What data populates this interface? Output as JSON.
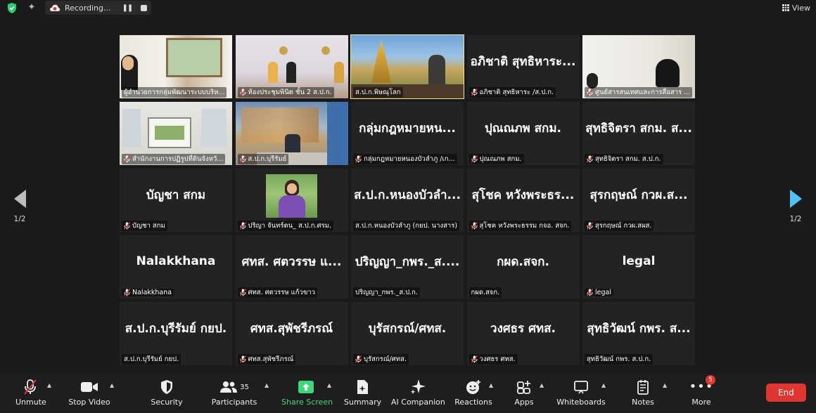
{
  "topbar": {
    "recording_label": "Recording...",
    "view_label": "View"
  },
  "gallery": {
    "tiles": [
      {
        "display_name": "",
        "label": "ผู้อำนวยการกลุ่มพัฒนาระบบบริห...",
        "muted": false,
        "has_video": true,
        "video": "v1"
      },
      {
        "display_name": "",
        "label": "ห้องประชุมพินิต ชั้น 2 ส.ป.ก.",
        "muted": true,
        "has_video": true,
        "video": "v2"
      },
      {
        "display_name": "",
        "label": "ส.ป.ก.พิษณุโลก",
        "muted": false,
        "has_video": true,
        "video": "v3",
        "active": true
      },
      {
        "display_name": "อภิชาติ สุทธิหาระ...",
        "label": "อภิชาติ สุทธิหาระ /ส.ป.ก.",
        "muted": true,
        "has_video": false
      },
      {
        "display_name": "",
        "label": "ศูนย์สารสนเทศและการสื่อสาร ...",
        "muted": true,
        "has_video": true,
        "video": "v5"
      },
      {
        "display_name": "",
        "label": "สำนักงานการปฏิรูปที่ดินจังหวั...",
        "muted": true,
        "has_video": true,
        "video": "v6"
      },
      {
        "display_name": "",
        "label": "ส.ป.ก.บุรีรัมย์",
        "muted": true,
        "has_video": true,
        "video": "v7"
      },
      {
        "display_name": "กลุ่มกฎหมายหน...",
        "label": "กลุ่มกฎหมายหนองบัวลำภู /เก...",
        "muted": true,
        "has_video": false
      },
      {
        "display_name": "ปุณณภพ สกม.",
        "label": "ปุณณภพ สกม.",
        "muted": true,
        "has_video": false
      },
      {
        "display_name": "สุทธิจิตรา สกม. ส...",
        "label": "สุทธิจิตรา สกม. ส.ป.ก.",
        "muted": true,
        "has_video": false
      },
      {
        "display_name": "บัญชา สกม",
        "label": "บัญชา สกม",
        "muted": true,
        "has_video": false
      },
      {
        "display_name": "",
        "label": "ปริญา จันทร์ตน_ ส.ป.ก.ศรม.",
        "muted": true,
        "has_video": true,
        "video": "photo"
      },
      {
        "display_name": "ส.ป.ก.หนองบัวลำ...",
        "label": "ส.ป.ก.หนองบัวลำภู (กยป. นางสาร)",
        "muted": false,
        "has_video": false
      },
      {
        "display_name": "สุโชค หวังพระธร...",
        "label": "สุโชค หวังพระธรรม กจอ. สจก.",
        "muted": true,
        "has_video": false
      },
      {
        "display_name": "สุรกฤษณ์ กวผ.ส...",
        "label": "สุรกฤษณ์ กวผ.สผส.",
        "muted": true,
        "has_video": false
      },
      {
        "display_name": "Nalakkhana",
        "label": "Nalakkhana",
        "muted": true,
        "has_video": false
      },
      {
        "display_name": "ศทส. ศตวรรษ แ...",
        "label": "ศทส. ศตวรรษ แก้วขาว",
        "muted": true,
        "has_video": false
      },
      {
        "display_name": "ปริญญา_กพร._ส....",
        "label": "ปริญญา_กพร._ส.ป.ก.",
        "muted": false,
        "has_video": false
      },
      {
        "display_name": "กผด.สจก.",
        "label": "กผด.สจก.",
        "muted": false,
        "has_video": false
      },
      {
        "display_name": "legal",
        "label": "legal",
        "muted": true,
        "has_video": false
      },
      {
        "display_name": "ส.ป.ก.บุรีรัมย์ กยป.",
        "label": "ส.ป.ก.บุรีรัมย์ กยป.",
        "muted": false,
        "has_video": false
      },
      {
        "display_name": "ศทส.สุพัชรีภรณ์",
        "label": "ศทส.สุพัชรีภรณ์",
        "muted": true,
        "has_video": false
      },
      {
        "display_name": "บุรัสกรณ์/ศทส.",
        "label": "บุรัสกรณ์/ศทส.",
        "muted": true,
        "has_video": false
      },
      {
        "display_name": "วงศธร ศทส.",
        "label": "วงศธร ศทส.",
        "muted": true,
        "has_video": false
      },
      {
        "display_name": "สุทธิวัฒน์ กพร. ส...",
        "label": "สุทธิวัฒน์ กพร. ส.ป.ก.",
        "muted": false,
        "has_video": false
      }
    ]
  },
  "pagination": {
    "left": "1/2",
    "right": "1/2"
  },
  "toolbar": {
    "unmute": "Unmute",
    "stop_video": "Stop Video",
    "security": "Security",
    "participants": "Participants",
    "participants_count": "35",
    "share_screen": "Share Screen",
    "summary": "Summary",
    "ai_companion": "AI Companion",
    "reactions": "Reactions",
    "apps": "Apps",
    "whiteboards": "Whiteboards",
    "notes": "Notes",
    "more": "More",
    "more_badge": "5",
    "end": "End"
  },
  "colors": {
    "background": "#1a1a1a",
    "tile": "#232323",
    "active_outline": "#f3e39a",
    "share_green": "#3ed67b",
    "end_red": "#e0362f",
    "nav_blue": "#4fc3f7",
    "mute_red": "#e0362f"
  }
}
